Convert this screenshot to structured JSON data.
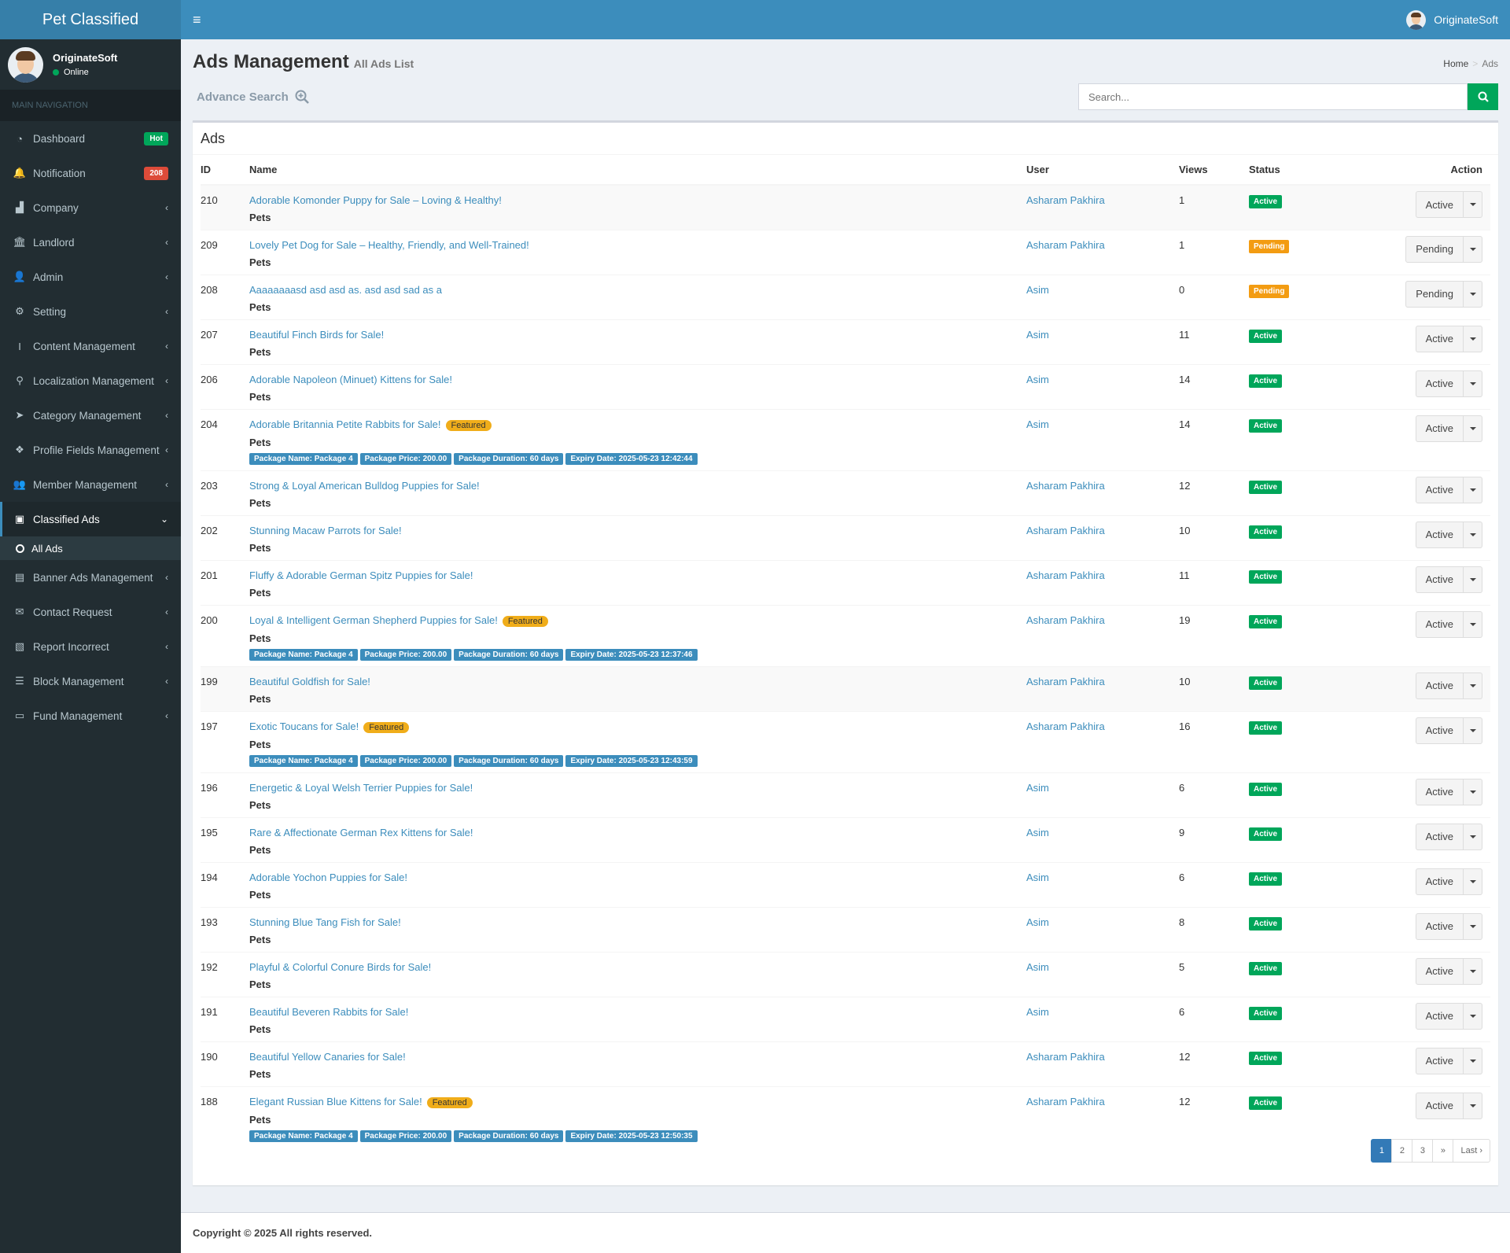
{
  "app": {
    "title": "Pet Classified"
  },
  "user": {
    "name": "OriginateSoft",
    "status": "Online"
  },
  "sidebar": {
    "nav_header": "MAIN NAVIGATION",
    "items": [
      {
        "label": "Dashboard",
        "icon": "dashboard-icon",
        "badge": "Hot"
      },
      {
        "label": "Notification",
        "icon": "bell-icon",
        "badge": "208"
      },
      {
        "label": "Company",
        "icon": "bar-chart-icon"
      },
      {
        "label": "Landlord",
        "icon": "bank-icon"
      },
      {
        "label": "Admin",
        "icon": "user-icon"
      },
      {
        "label": "Setting",
        "icon": "gear-icon"
      },
      {
        "label": "Content Management",
        "icon": "text-cursor-icon"
      },
      {
        "label": "Localization Management",
        "icon": "map-marker-icon"
      },
      {
        "label": "Category Management",
        "icon": "pointer-icon"
      },
      {
        "label": "Profile Fields Management",
        "icon": "cubes-icon"
      },
      {
        "label": "Member Management",
        "icon": "users-icon"
      },
      {
        "label": "Classified Ads",
        "icon": "briefcase-icon"
      },
      {
        "label": "Banner Ads Management",
        "icon": "newspaper-icon"
      },
      {
        "label": "Contact Request",
        "icon": "envelope-icon"
      },
      {
        "label": "Report Incorrect",
        "icon": "report-file-icon"
      },
      {
        "label": "Block Management",
        "icon": "list-icon"
      },
      {
        "label": "Fund Management",
        "icon": "money-icon"
      }
    ],
    "sub_item": "All Ads"
  },
  "page": {
    "title": "Ads Management",
    "subtitle": "All Ads List",
    "breadcrumb": {
      "home": "Home",
      "current": "Ads"
    },
    "advance_search": "Advance Search",
    "search_placeholder": "Search...",
    "box_title": "Ads"
  },
  "table": {
    "headers": {
      "id": "ID",
      "name": "Name",
      "user": "User",
      "views": "Views",
      "status": "Status",
      "action": "Action"
    },
    "rows": [
      {
        "id": "210",
        "name": "Adorable Komonder Puppy for Sale – Loving & Healthy!",
        "category": "Pets",
        "user": "Asharam Pakhira",
        "views": "1",
        "status": "Active",
        "action": "Active"
      },
      {
        "id": "209",
        "name": "Lovely Pet Dog for Sale – Healthy, Friendly, and Well-Trained!",
        "category": "Pets",
        "user": "Asharam Pakhira",
        "views": "1",
        "status": "Pending",
        "action": "Pending"
      },
      {
        "id": "208",
        "name": "Aaaaaaaasd asd asd as. asd asd sad as a",
        "category": "Pets",
        "user": "Asim",
        "views": "0",
        "status": "Pending",
        "action": "Pending"
      },
      {
        "id": "207",
        "name": "Beautiful Finch Birds for Sale!",
        "category": "Pets",
        "user": "Asim",
        "views": "11",
        "status": "Active",
        "action": "Active"
      },
      {
        "id": "206",
        "name": "Adorable Napoleon (Minuet) Kittens for Sale!",
        "category": "Pets",
        "user": "Asim",
        "views": "14",
        "status": "Active",
        "action": "Active"
      },
      {
        "id": "204",
        "name": "Adorable Britannia Petite Rabbits for Sale!",
        "category": "Pets",
        "user": "Asim",
        "views": "14",
        "status": "Active",
        "action": "Active",
        "featured": "Featured",
        "package": [
          "Package Name: Package 4",
          "Package Price: 200.00",
          "Package Duration: 60 days",
          "Expiry Date: 2025-05-23 12:42:44"
        ]
      },
      {
        "id": "203",
        "name": "Strong & Loyal American Bulldog Puppies for Sale!",
        "category": "Pets",
        "user": "Asharam Pakhira",
        "views": "12",
        "status": "Active",
        "action": "Active"
      },
      {
        "id": "202",
        "name": "Stunning Macaw Parrots for Sale!",
        "category": "Pets",
        "user": "Asharam Pakhira",
        "views": "10",
        "status": "Active",
        "action": "Active"
      },
      {
        "id": "201",
        "name": "Fluffy & Adorable German Spitz Puppies for Sale!",
        "category": "Pets",
        "user": "Asharam Pakhira",
        "views": "11",
        "status": "Active",
        "action": "Active"
      },
      {
        "id": "200",
        "name": "Loyal & Intelligent German Shepherd Puppies for Sale!",
        "category": "Pets",
        "user": "Asharam Pakhira",
        "views": "19",
        "status": "Active",
        "action": "Active",
        "featured": "Featured",
        "package": [
          "Package Name: Package 4",
          "Package Price: 200.00",
          "Package Duration: 60 days",
          "Expiry Date: 2025-05-23 12:37:46"
        ]
      },
      {
        "id": "199",
        "name": "Beautiful Goldfish for Sale!",
        "category": "Pets",
        "user": "Asharam Pakhira",
        "views": "10",
        "status": "Active",
        "action": "Active"
      },
      {
        "id": "197",
        "name": "Exotic Toucans for Sale!",
        "category": "Pets",
        "user": "Asharam Pakhira",
        "views": "16",
        "status": "Active",
        "action": "Active",
        "featured": "Featured",
        "package": [
          "Package Name: Package 4",
          "Package Price: 200.00",
          "Package Duration: 60 days",
          "Expiry Date: 2025-05-23 12:43:59"
        ]
      },
      {
        "id": "196",
        "name": "Energetic & Loyal Welsh Terrier Puppies for Sale!",
        "category": "Pets",
        "user": "Asim",
        "views": "6",
        "status": "Active",
        "action": "Active"
      },
      {
        "id": "195",
        "name": "Rare & Affectionate German Rex Kittens for Sale!",
        "category": "Pets",
        "user": "Asim",
        "views": "9",
        "status": "Active",
        "action": "Active"
      },
      {
        "id": "194",
        "name": "Adorable Yochon Puppies for Sale!",
        "category": "Pets",
        "user": "Asim",
        "views": "6",
        "status": "Active",
        "action": "Active"
      },
      {
        "id": "193",
        "name": "Stunning Blue Tang Fish for Sale!",
        "category": "Pets",
        "user": "Asim",
        "views": "8",
        "status": "Active",
        "action": "Active"
      },
      {
        "id": "192",
        "name": "Playful & Colorful Conure Birds for Sale!",
        "category": "Pets",
        "user": "Asim",
        "views": "5",
        "status": "Active",
        "action": "Active"
      },
      {
        "id": "191",
        "name": "Beautiful Beveren Rabbits for Sale!",
        "category": "Pets",
        "user": "Asim",
        "views": "6",
        "status": "Active",
        "action": "Active"
      },
      {
        "id": "190",
        "name": "Beautiful Yellow Canaries for Sale!",
        "category": "Pets",
        "user": "Asharam Pakhira",
        "views": "12",
        "status": "Active",
        "action": "Active"
      },
      {
        "id": "188",
        "name": "Elegant Russian Blue Kittens for Sale!",
        "category": "Pets",
        "user": "Asharam Pakhira",
        "views": "12",
        "status": "Active",
        "action": "Active",
        "featured": "Featured",
        "package": [
          "Package Name: Package 4",
          "Package Price: 200.00",
          "Package Duration: 60 days",
          "Expiry Date: 2025-05-23 12:50:35"
        ]
      }
    ]
  },
  "pagination": {
    "pages": [
      "1",
      "2",
      "3"
    ],
    "next": "»",
    "last": "Last ›",
    "current": "1"
  },
  "footer": {
    "copyright": "Copyright © 2025 All rights reserved."
  },
  "colors": {
    "primary": "#3c8dbc",
    "sidebar": "#222d32",
    "success": "#00a65a",
    "warning": "#f39c12",
    "danger": "#dd4b39"
  }
}
